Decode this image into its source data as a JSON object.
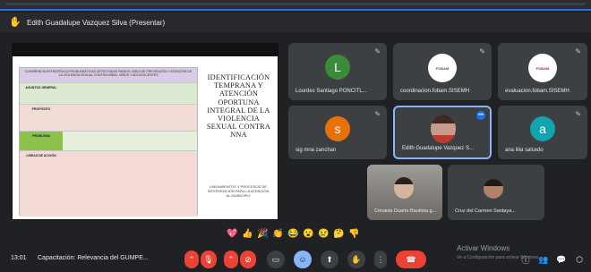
{
  "presenter": {
    "label": "Edith Guadalupe Vazquez Silva (Presentar)"
  },
  "slide": {
    "table_title": "COHERENCIA ESTRATÉGICA\nPROBLEMÁTICAS DETECTADAS PARA EL ÁREA DE PREVENCIÓN Y ATENCIÓN DE LA VIOLENCIA SEXUAL CONTRA NIÑAS, NIÑOS Y ADOLESCENTES",
    "row_labels": [
      "ASUNTOS GENERAL",
      "PROPÓSITO",
      "PROBLEMA",
      "LÍNEAS DE ACCIÓN"
    ],
    "title": "IDENTIFICACIÓN TEMPRANA Y ATENCIÓN OPORTUNA INTEGRAL DE LA VIOLENCIA SEXUAL CONTRA NNA",
    "subtitle": "LINEAMIENTOS Y PROCESOS DE INTERVENCIÓN PARA LA ATENCIÓN AL MUNICIPIO"
  },
  "participants": [
    {
      "label": "Lourdes Santiago PONCITL...",
      "initial": "L",
      "color": "#3c8a3c"
    },
    {
      "label": "coordinacion.fobam.SISEMH",
      "logo": "FOBAM"
    },
    {
      "label": "evaluacion.fobam.SISEMH",
      "logo": "FOBAM"
    },
    {
      "label": "sig mna zanchan",
      "initial": "s",
      "color": "#e8710a"
    },
    {
      "label": "Edith Guadalupe Vazquez S...",
      "photo": true
    },
    {
      "label": "ana lilia salcedo",
      "initial": "a",
      "color": "#12a4af"
    },
    {
      "label": "Cenaida Duarte Bautista g...",
      "photo": true
    },
    {
      "label": "Cruz del Carmen Santaya...",
      "photo": true
    }
  ],
  "reactions": [
    "💖",
    "👍",
    "🎉",
    "👏",
    "😂",
    "😮",
    "😢",
    "🤔",
    "👎"
  ],
  "bottom": {
    "time": "13:01",
    "meeting": "Capacitación: Relevancia del GUMPE..."
  },
  "watermark": {
    "line1": "Activar Windows",
    "line2": "Ve a Configuración para activar Windows."
  }
}
